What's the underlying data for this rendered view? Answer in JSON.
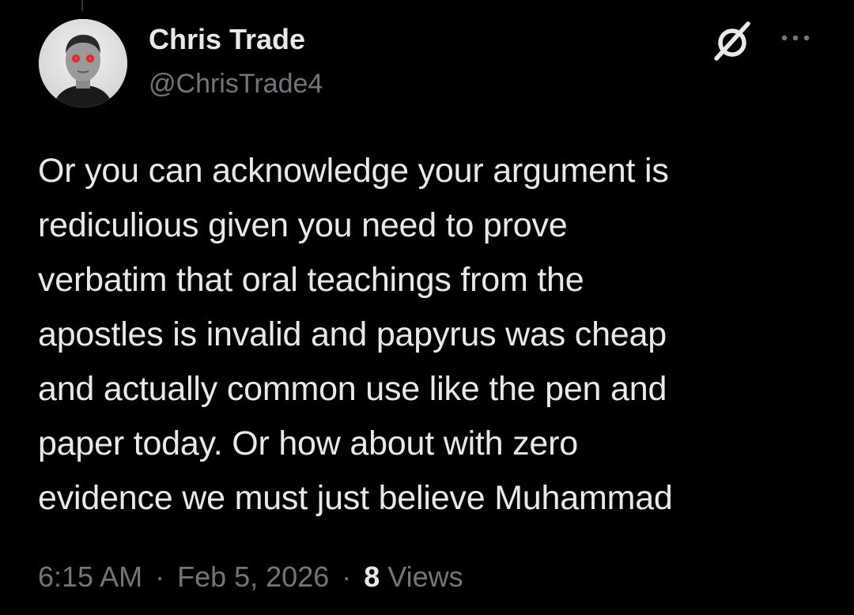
{
  "author": {
    "display_name": "Chris Trade",
    "handle": "@ChrisTrade4"
  },
  "tweet": {
    "text": "Or you can acknowledge your argument is\nrediculious given you need to prove\nverbatim that oral teachings from the\napostles is invalid and papyrus was cheap\nand actually common use like the pen and\npaper today. Or how about with zero\nevidence we must just believe Muhammad"
  },
  "meta": {
    "time": "6:15 AM",
    "separator": "·",
    "date": "Feb 5, 2026",
    "views_count": "8",
    "views_label": "Views"
  },
  "icons": {
    "header_right": [
      "grok-icon",
      "more-options-icon"
    ]
  },
  "colors": {
    "background": "#000000",
    "primary_text": "#e7e9ea",
    "secondary_text": "#71767b"
  }
}
